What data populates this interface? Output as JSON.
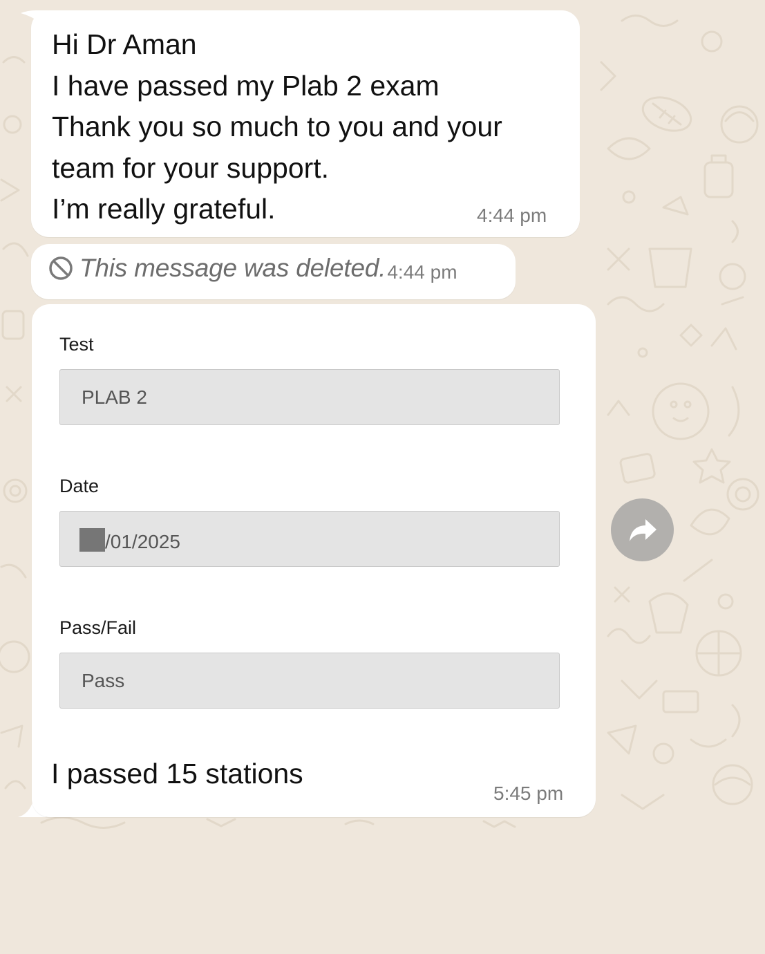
{
  "chat": {
    "messages": [
      {
        "type": "text",
        "lines": [
          "Hi Dr Aman",
          "I have passed my Plab 2 exam",
          "Thank you so much to you and your",
          "team for your support.",
          "I’m really grateful."
        ],
        "time": "4:44 pm"
      },
      {
        "type": "deleted",
        "text": "This message was deleted.",
        "time": "4:44 pm",
        "icon": "prohibited-icon"
      },
      {
        "type": "image_with_caption",
        "form": {
          "test_label": "Test",
          "test_value": "PLAB 2",
          "date_label": "Date",
          "date_value": "/01/2025",
          "passfail_label": "Pass/Fail",
          "passfail_value": "Pass"
        },
        "caption": "I passed 15 stations",
        "time": "5:45 pm"
      }
    ],
    "forward_button": {
      "icon": "forward-arrow-icon"
    }
  },
  "colors": {
    "wallpaper": "#efe7dc",
    "bubble": "#ffffff",
    "field_bg": "#e4e4e4",
    "timestamp": "#7b7b7b"
  }
}
